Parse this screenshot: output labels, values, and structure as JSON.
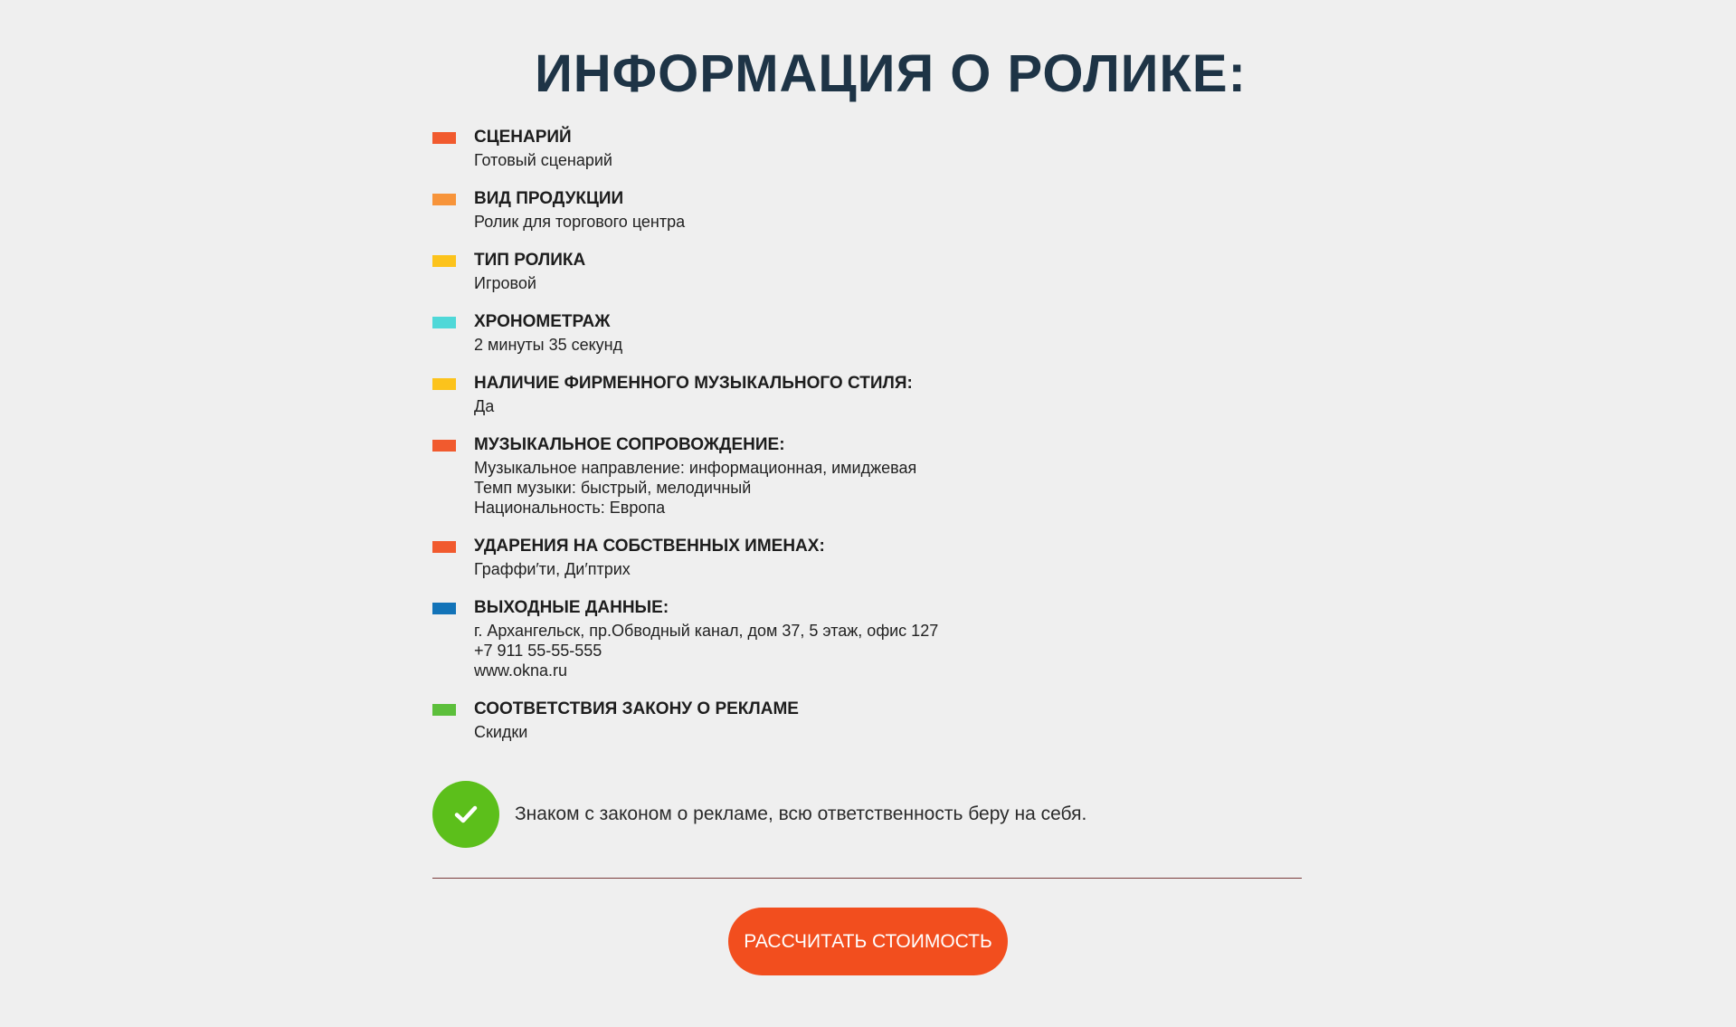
{
  "title": "ИНФОРМАЦИЯ О РОЛИКЕ:",
  "items": [
    {
      "label": "СЦЕНАРИЙ",
      "value": "Готовый сценарий",
      "color": "#f15a2e"
    },
    {
      "label": "ВИД ПРОДУКЦИИ",
      "value": "Ролик для торгового центра",
      "color": "#f7943a"
    },
    {
      "label": "ТИП РОЛИКА",
      "value": "Игровой",
      "color": "#fcc31c"
    },
    {
      "label": "ХРОНОМЕТРАЖ",
      "value": "2 минуты 35 секунд",
      "color": "#4fd8d8"
    },
    {
      "label": "НАЛИЧИЕ ФИРМЕННОГО МУЗЫКАЛЬНОГО СТИЛЯ:",
      "value": "Да",
      "color": "#fcc31c"
    },
    {
      "label": "МУЗЫКАЛЬНОЕ СОПРОВОЖДЕНИЕ:",
      "value": "Музыкальное направление: информационная, имиджевая\nТемп музыки: быстрый, мелодичный\nНациональность: Европа",
      "color": "#f15a2e"
    },
    {
      "label": "УДАРЕНИЯ НА СОБСТВЕННЫХ ИМЕНАХ:",
      "value": "Граффи′ти, Ди′птрих",
      "color": "#f15a2e"
    },
    {
      "label": "ВЫХОДНЫЕ ДАННЫЕ:",
      "value": "г. Архангельск, пр.Обводный канал, дом 37, 5 этаж, офис 127\n+7 911 55-55-555\nwww.okna.ru",
      "color": "#1273b8"
    },
    {
      "label": "СООТВЕТСТВИЯ ЗАКОНУ О РЕКЛАМЕ",
      "value": "Скидки",
      "color": "#5cbf3b"
    }
  ],
  "consent": {
    "text": "Знаком с законом о рекламе, всю ответственность беру на себя.",
    "checked": true,
    "color": "#5cbf1b"
  },
  "button": {
    "label": "РАССЧИТАТЬ СТОИМОСТЬ",
    "color": "#f24e1e"
  }
}
